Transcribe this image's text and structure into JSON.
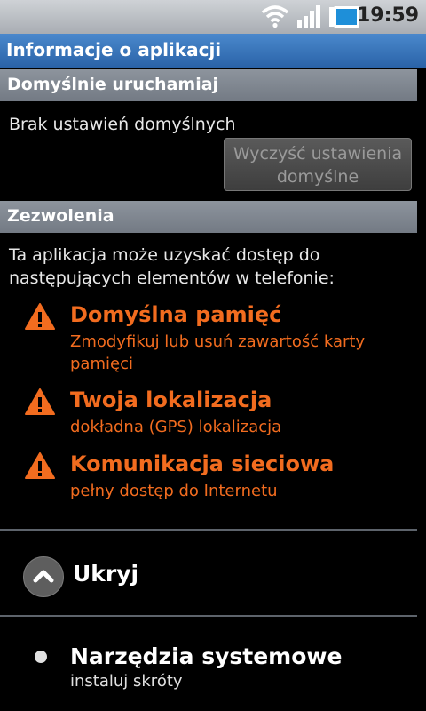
{
  "status_bar": {
    "time": "19:59",
    "icons": [
      "wifi-icon",
      "signal-icon",
      "battery-icon"
    ]
  },
  "title": "Informacje o aplikacji",
  "defaults_section": {
    "header": "Domyślnie uruchamiaj",
    "text": "Brak ustawień domyślnych",
    "clear_button": {
      "line1": "Wyczyść ustawienia",
      "line2": "domyślne"
    }
  },
  "permissions_section": {
    "header": "Zezwolenia",
    "intro_line1": "Ta aplikacja może uzyskać dostęp do",
    "intro_line2": "następujących elementów w telefonie:",
    "items": [
      {
        "name": "Domyślna pamięć",
        "desc_line1": "Zmodyfikuj lub usuń zawartość karty",
        "desc_line2": "pamięci"
      },
      {
        "name": "Twoja lokalizacja",
        "desc_line1": "dokładna (GPS) lokalizacja",
        "desc_line2": ""
      },
      {
        "name": "Komunikacja sieciowa",
        "desc_line1": "pełny dostęp do Internetu",
        "desc_line2": ""
      }
    ]
  },
  "hide_toggle": {
    "label": "Ukryj"
  },
  "system_tools": {
    "name": "Narzędzia systemowe",
    "desc": "instaluj skróty"
  },
  "colors": {
    "warning": "#f26c1f",
    "title_bar": "#2a63a8",
    "section_header": "#7e858e"
  }
}
